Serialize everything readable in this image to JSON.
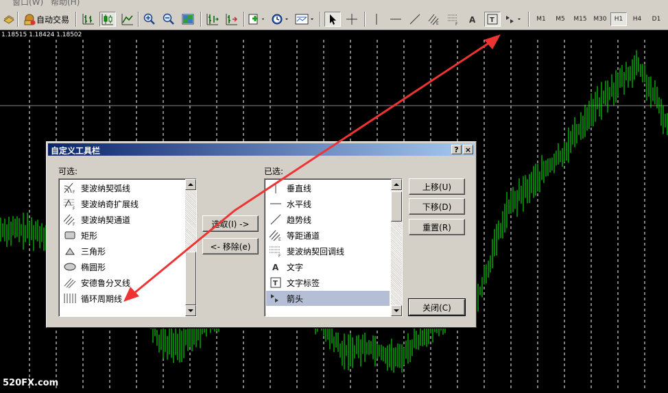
{
  "menu": {
    "window": "窗口(W)",
    "help": "帮助(H)"
  },
  "toolbar": {
    "auto_trade_label": "自动交易",
    "timeframes": [
      "M1",
      "M5",
      "M15",
      "M30",
      "H1",
      "H4",
      "D1"
    ],
    "active_timeframe": "H1"
  },
  "chart": {
    "price_line": "1.18515 1.18424 1.18502",
    "watermark": "520FX.com",
    "candle_color": "#00ff00",
    "background": "#000000"
  },
  "dialog": {
    "title": "自定义工具栏",
    "help_button": "?",
    "close_glyph": "×",
    "available_label": "可选:",
    "selected_label": "已选:",
    "available_items": [
      {
        "label": "斐波纳契弧线",
        "icon": "fibonacci-arcs-icon"
      },
      {
        "label": "斐波纳奇扩展线",
        "icon": "fibonacci-expansion-icon"
      },
      {
        "label": "斐波纳契通道",
        "icon": "fibonacci-channel-icon"
      },
      {
        "label": "矩形",
        "icon": "rectangle-icon"
      },
      {
        "label": "三角形",
        "icon": "triangle-icon"
      },
      {
        "label": "椭圆形",
        "icon": "ellipse-icon"
      },
      {
        "label": "安德鲁分叉线",
        "icon": "andrews-pitchfork-icon"
      },
      {
        "label": "循环周期线",
        "icon": "cycle-lines-icon"
      }
    ],
    "selected_items": [
      {
        "label": "垂直线",
        "icon": "vertical-line-icon"
      },
      {
        "label": "水平线",
        "icon": "horizontal-line-icon"
      },
      {
        "label": "趋势线",
        "icon": "trendline-icon"
      },
      {
        "label": "等距通道",
        "icon": "equidistant-channel-icon"
      },
      {
        "label": "斐波纳契回调线",
        "icon": "fibonacci-retracement-icon"
      },
      {
        "label": "文字",
        "icon": "text-icon"
      },
      {
        "label": "文字标签",
        "icon": "text-label-icon"
      },
      {
        "label": "箭头",
        "icon": "arrows-icon"
      }
    ],
    "selected_highlight_index": 7,
    "add_button": "选取(I) ->",
    "remove_button": "<- 移除(e)",
    "move_up_button": "上移(U)",
    "move_down_button": "下移(D)",
    "reset_button": "重置(R)",
    "close_button": "关闭(C)"
  },
  "annotation": {
    "arrow_color": "#ee3333"
  }
}
